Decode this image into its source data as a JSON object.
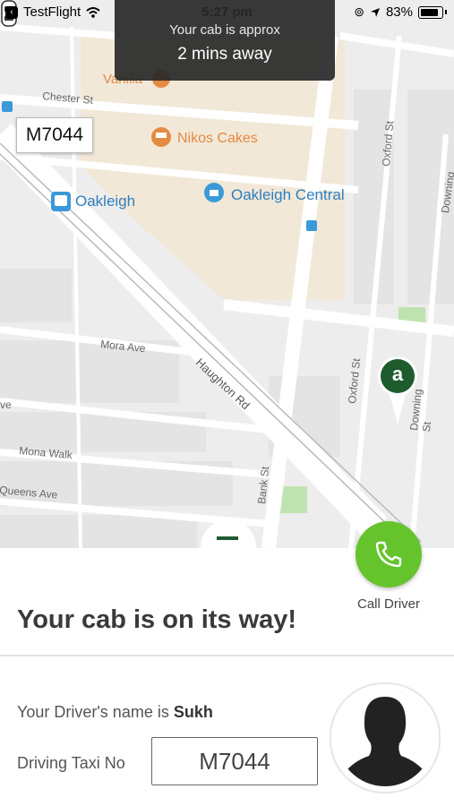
{
  "status_bar": {
    "back_app": "TestFlight",
    "time": "5:27 pm",
    "battery": "83%"
  },
  "toast": {
    "line1": "Your cab is approx",
    "line2": "2 mins away"
  },
  "map": {
    "places": [
      "Vanilla",
      "Nikos Cakes",
      "Oakleigh",
      "Oakleigh Central"
    ],
    "streets": [
      "Chester St",
      "Oxford St",
      "Downing St",
      "Mora Ave",
      "Haughton Rd",
      "Oxford St",
      "Downing St",
      "Mona Walk",
      "Queens Ave",
      "Bank St",
      "ve"
    ],
    "taxi_label": "M7044",
    "destination_marker": "a"
  },
  "call": {
    "label": "Call Driver"
  },
  "panel": {
    "title": "Your cab is on its way!",
    "driver_prefix": "Your Driver's name is ",
    "driver_name": "Sukh",
    "taxi_label": "Driving Taxi No",
    "taxi_no": "M7044"
  },
  "colors": {
    "accent_green": "#65c42b",
    "marker_green": "#1e5b2d",
    "poi_orange": "#e58a42",
    "poi_blue": "#3a9ad9"
  },
  "icons": {
    "signal": "wifi-icon",
    "location": "location-arrow-icon",
    "call": "phone-icon",
    "avatar": "person-silhouette-icon"
  }
}
